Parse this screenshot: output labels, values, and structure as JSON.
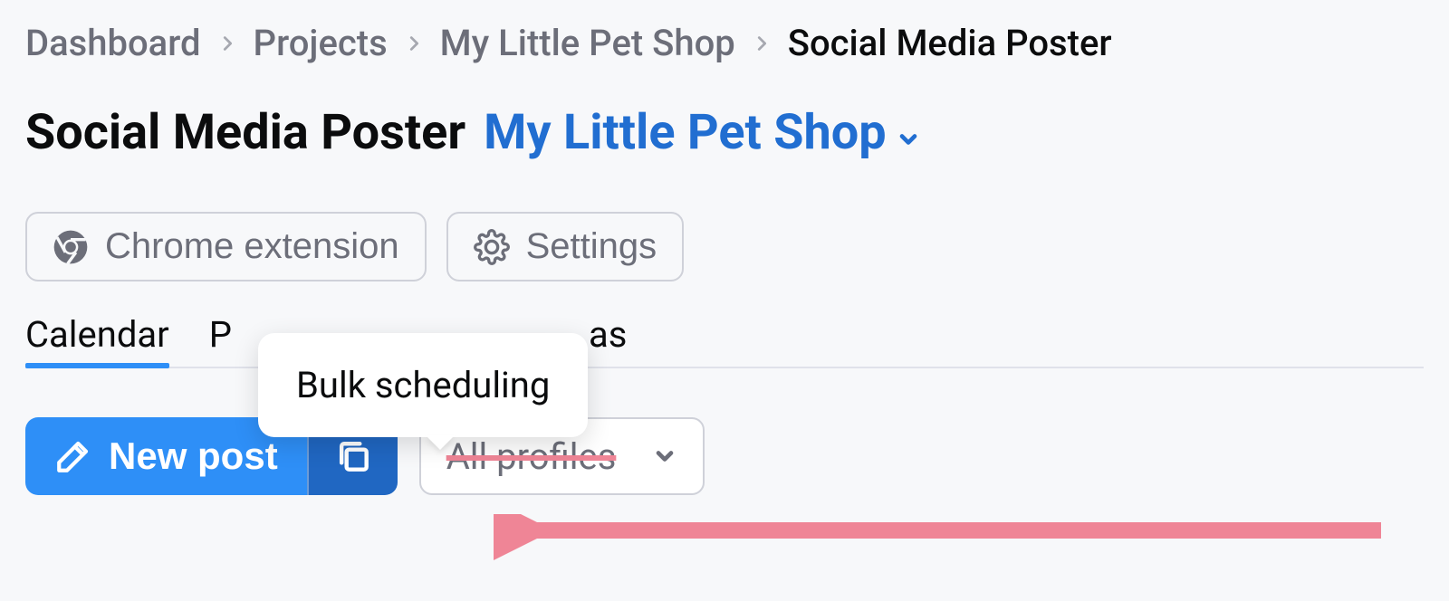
{
  "breadcrumb": {
    "items": [
      "Dashboard",
      "Projects",
      "My Little Pet Shop",
      "Social Media Poster"
    ]
  },
  "header": {
    "title": "Social Media Poster",
    "project": "My Little Pet Shop"
  },
  "buttons": {
    "chrome_ext": "Chrome extension",
    "settings": "Settings"
  },
  "tabs": {
    "calendar": "Calendar",
    "posts_prefix": "P",
    "ideas_suffix": "as"
  },
  "toolbar": {
    "new_post": "New post",
    "all_profiles": "All profiles"
  },
  "tooltip": {
    "bulk_scheduling": "Bulk scheduling"
  }
}
